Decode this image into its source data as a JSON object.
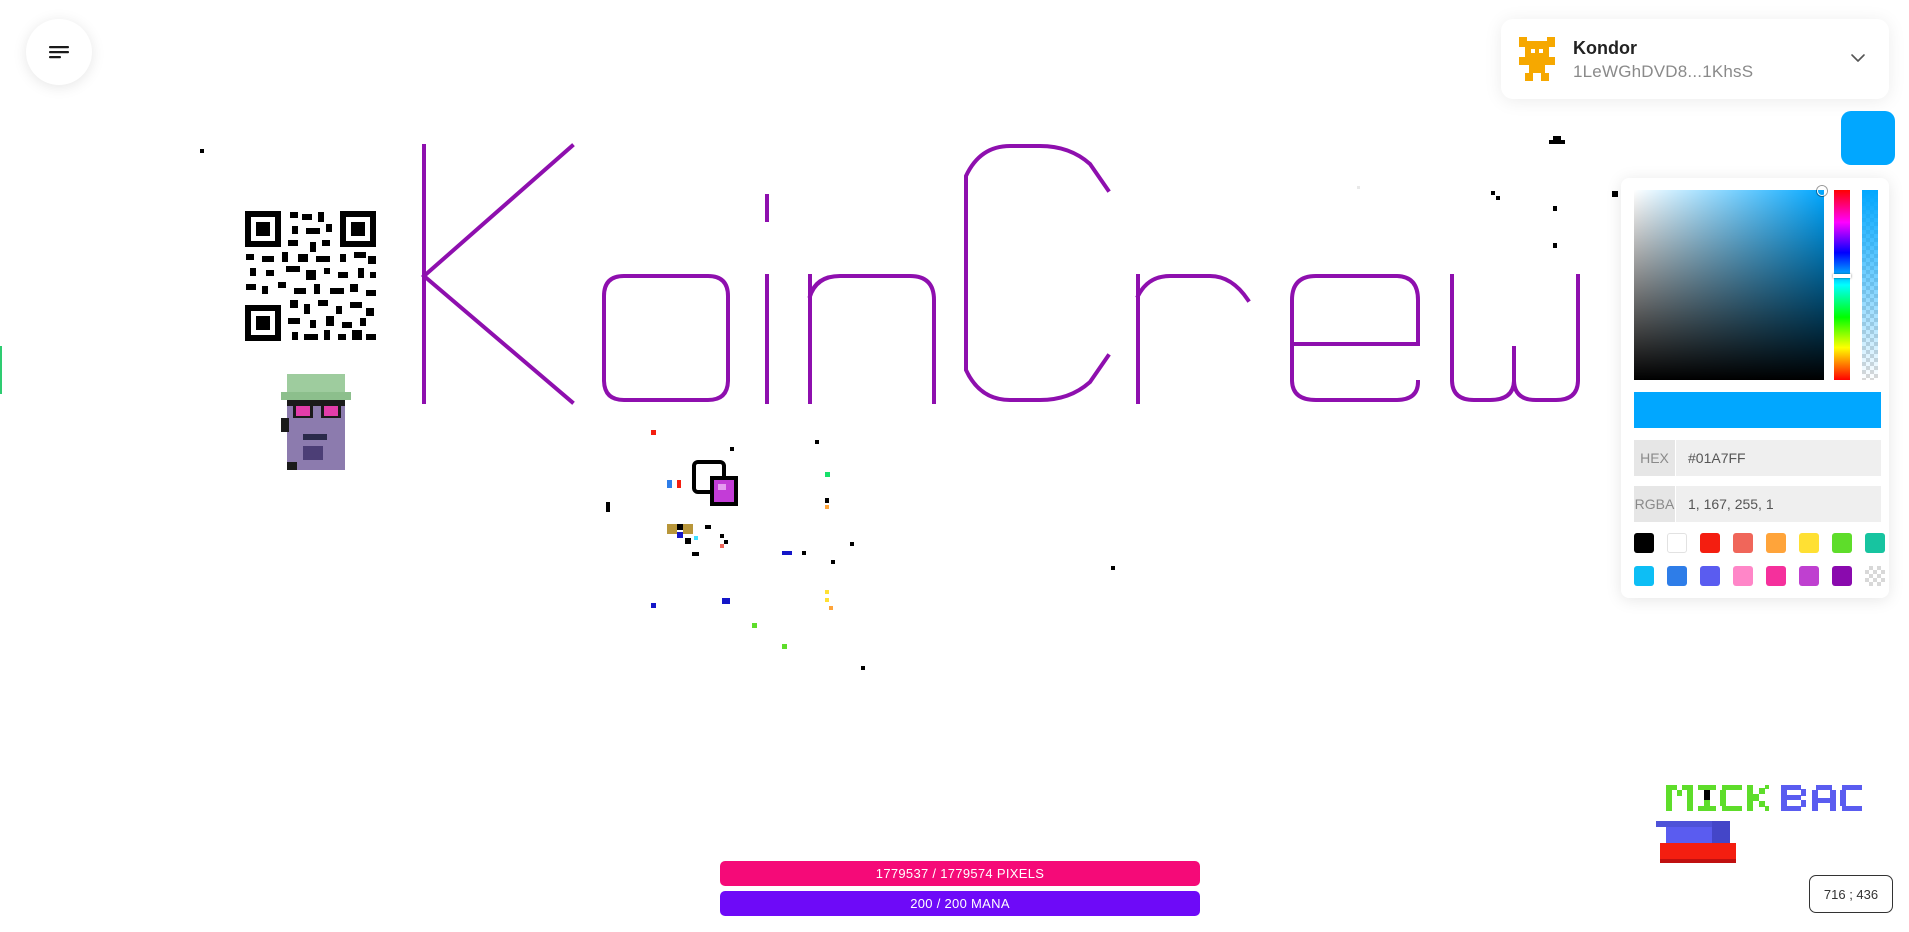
{
  "menu": {
    "icon": "hamburger-menu-icon"
  },
  "account": {
    "name": "Kondor",
    "address": "1LeWGhDVD8...1KhsS",
    "avatar_icon": "pixel-avatar-icon",
    "chevron_icon": "chevron-down-icon"
  },
  "current_color": "#01A7FF",
  "picker": {
    "hex_label": "HEX",
    "hex_value": "#01A7FF",
    "rgba_label": "RGBA",
    "rgba_value": "1, 167, 255, 1",
    "swatches": [
      "#000000",
      "#FFFFFF",
      "#F41E10",
      "#F0665A",
      "#FFA43A",
      "#FFE033",
      "#5EDD2A",
      "#17C4A0",
      "#0DBEF5",
      "#2E7DE8",
      "#5A5CF0",
      "#FF86C8",
      "#F5309C",
      "#BF40D0",
      "#8A0AAE",
      "transparent"
    ]
  },
  "canvas": {
    "artwork_text_1": "KoinCrew",
    "artwork_text_2": "MICK BAC",
    "artwork_color": "#8E0FAE"
  },
  "status": {
    "pixels_label": "1779537 / 1779574 PIXELS",
    "pixels_color": "#F50A78",
    "mana_label": "200 / 200 MANA",
    "mana_color": "#6E0AF8"
  },
  "coordinates": "716 ; 436"
}
